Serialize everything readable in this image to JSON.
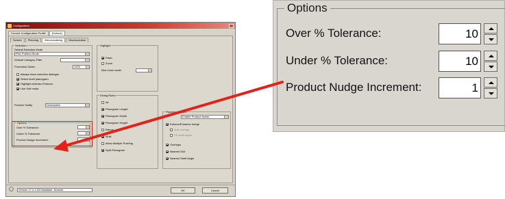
{
  "dialog": {
    "title": "Configuration",
    "tabs_top": [
      "Current Configuration Profile",
      "[Default]"
    ],
    "tabs_sub": [
      "Screen",
      "Picturing",
      "Merchandising",
      "Macrosolution"
    ],
    "selection": {
      "group_label": "Selection",
      "mode_label": "Default Selection Mode",
      "mode_value": "Pick Position Mode",
      "vertical_label": "Vertical Category Filter",
      "promo_label": "Promotion Dates",
      "promo_value": "1000",
      "checks": [
        "Always show selection dialogue",
        "Select shelf planogram",
        "Highlight selected Fixtures",
        "Use Soft mode"
      ]
    },
    "product_tooltip": {
      "label": "Product Tooltip",
      "value": "Description"
    },
    "highlight": {
      "group_label": "Highlight",
      "checks": [
        "Flash",
        "Zoom"
      ],
      "max_zoom_label": "Max zoom scale",
      "max_zoom_value": "4.0"
    },
    "diving_rules": {
      "group_label": "Diving Rules",
      "checks": [
        "All",
        "Planogram Length",
        "Planogram Depth",
        "Planogram Height",
        "Range",
        "Multi",
        "Allow Multiple Pushing",
        "Split Planogram"
      ]
    },
    "placement": {
      "group_label": "Placement Rules",
      "dropdown_value": "Enable Product Name",
      "checks": [
        "Enforce/Enhance merge",
        "Auto facings",
        "Fill shelf space",
        "Overlaps",
        "Nearest Slot",
        "Nearest Shelf Angle"
      ]
    },
    "options_small": {
      "group_label": "Options",
      "rows": [
        {
          "label": "Over % Tolerance:",
          "value": "10"
        },
        {
          "label": "Under % Tolerance:",
          "value": "10"
        },
        {
          "label": "Product Nudge Increment:",
          "value": "1"
        }
      ]
    },
    "status": {
      "text": "Version 17.2.1.63  Database: Nomine",
      "ok_label": "OK",
      "cancel_label": "Cancel"
    }
  },
  "options_zoom": {
    "title": "Options",
    "rows": [
      {
        "label": "Over % Tolerance:",
        "value": "10"
      },
      {
        "label": "Under % Tolerance:",
        "value": "10"
      },
      {
        "label": "Product Nudge Increment:",
        "value": "1"
      }
    ]
  },
  "colors": {
    "arrow": "#e0231b",
    "highlight": "#c0231b",
    "dialog_bg": "#d7d3c9",
    "title_bar": "#b8302a"
  },
  "icons": [
    "app-icon",
    "close-icon",
    "spin-up-icon",
    "spin-down-icon",
    "callout-arrow-icon"
  ]
}
